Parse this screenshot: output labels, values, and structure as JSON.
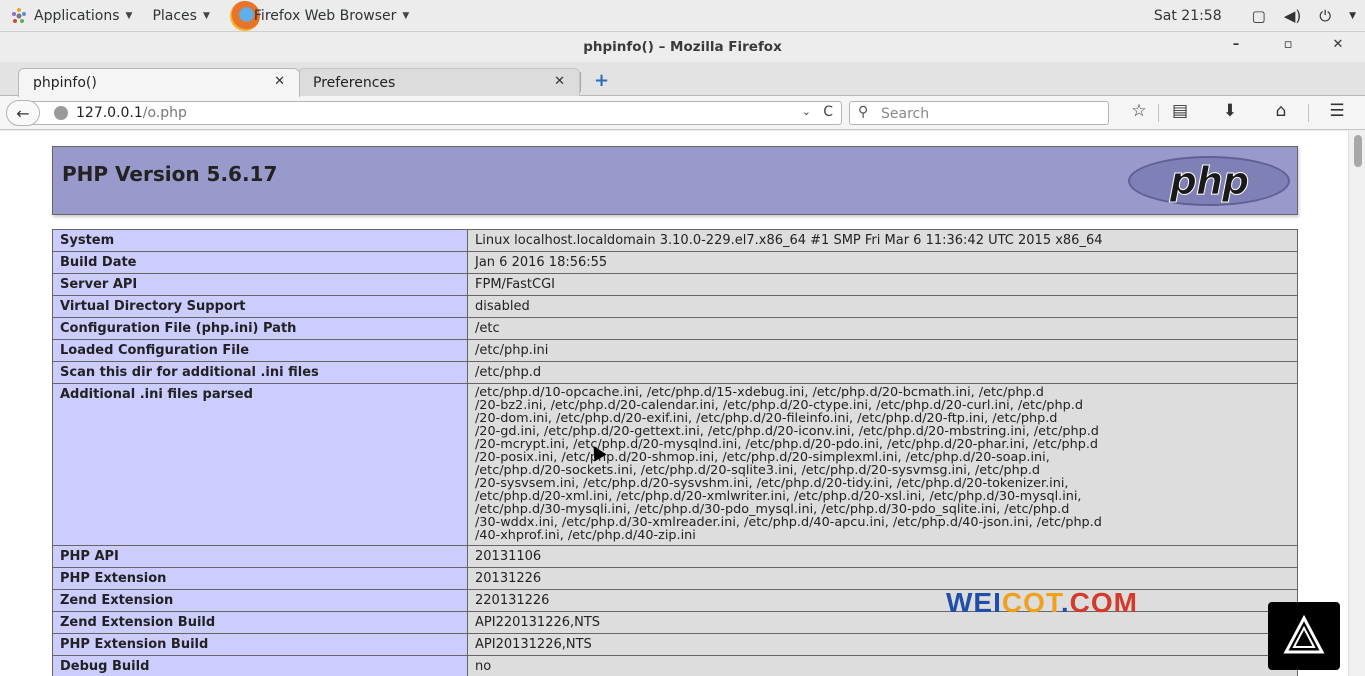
{
  "topbar": {
    "applications": "Applications",
    "places": "Places",
    "app_name": "Firefox Web Browser",
    "clock": "Sat 21:58"
  },
  "window": {
    "title": "phpinfo() – Mozilla Firefox",
    "minimize": "–",
    "maximize": "▫",
    "close": "✕"
  },
  "tabs": [
    {
      "label": "phpinfo()",
      "close": "✕"
    },
    {
      "label": "Preferences",
      "close": "✕"
    }
  ],
  "newtab": "+",
  "nav": {
    "url_host": "127.0.0.1",
    "url_path": "/o.php",
    "search_placeholder": "Search",
    "back": "←",
    "reload": "C",
    "url_dropdown": "⌄"
  },
  "php": {
    "version_title": "PHP Version 5.6.17",
    "logo": "php"
  },
  "info_rows": [
    {
      "key": "System",
      "value": "Linux localhost.localdomain 3.10.0-229.el7.x86_64 #1 SMP Fri Mar 6 11:36:42 UTC 2015 x86_64"
    },
    {
      "key": "Build Date",
      "value": "Jan 6 2016 18:56:55"
    },
    {
      "key": "Server API",
      "value": "FPM/FastCGI"
    },
    {
      "key": "Virtual Directory Support",
      "value": "disabled"
    },
    {
      "key": "Configuration File (php.ini) Path",
      "value": "/etc"
    },
    {
      "key": "Loaded Configuration File",
      "value": "/etc/php.ini"
    },
    {
      "key": "Scan this dir for additional .ini files",
      "value": "/etc/php.d"
    },
    {
      "key": "Additional .ini files parsed",
      "value": "/etc/php.d/10-opcache.ini, /etc/php.d/15-xdebug.ini, /etc/php.d/20-bcmath.ini, /etc/php.d\n/20-bz2.ini, /etc/php.d/20-calendar.ini, /etc/php.d/20-ctype.ini, /etc/php.d/20-curl.ini, /etc/php.d\n/20-dom.ini, /etc/php.d/20-exif.ini, /etc/php.d/20-fileinfo.ini, /etc/php.d/20-ftp.ini, /etc/php.d\n/20-gd.ini, /etc/php.d/20-gettext.ini, /etc/php.d/20-iconv.ini, /etc/php.d/20-mbstring.ini, /etc/php.d\n/20-mcrypt.ini, /etc/php.d/20-mysqlnd.ini, /etc/php.d/20-pdo.ini, /etc/php.d/20-phar.ini, /etc/php.d\n/20-posix.ini, /etc/php.d/20-shmop.ini, /etc/php.d/20-simplexml.ini, /etc/php.d/20-soap.ini,\n/etc/php.d/20-sockets.ini, /etc/php.d/20-sqlite3.ini, /etc/php.d/20-sysvmsg.ini, /etc/php.d\n/20-sysvsem.ini, /etc/php.d/20-sysvshm.ini, /etc/php.d/20-tidy.ini, /etc/php.d/20-tokenizer.ini,\n/etc/php.d/20-xml.ini, /etc/php.d/20-xmlwriter.ini, /etc/php.d/20-xsl.ini, /etc/php.d/30-mysql.ini,\n/etc/php.d/30-mysqli.ini, /etc/php.d/30-pdo_mysql.ini, /etc/php.d/30-pdo_sqlite.ini, /etc/php.d\n/30-wddx.ini, /etc/php.d/30-xmlreader.ini, /etc/php.d/40-apcu.ini, /etc/php.d/40-json.ini, /etc/php.d\n/40-xhprof.ini, /etc/php.d/40-zip.ini"
    },
    {
      "key": "PHP API",
      "value": "20131106"
    },
    {
      "key": "PHP Extension",
      "value": "20131226"
    },
    {
      "key": "Zend Extension",
      "value": "220131226"
    },
    {
      "key": "Zend Extension Build",
      "value": "API220131226,NTS"
    },
    {
      "key": "PHP Extension Build",
      "value": "API20131226,NTS"
    },
    {
      "key": "Debug Build",
      "value": "no"
    }
  ],
  "watermark": {
    "part1": "WEI",
    "part2": "COT",
    "part3": ".",
    "part4": "COM"
  },
  "colors": {
    "php_header": "#9999cc",
    "key_cell": "#ccccff",
    "value_cell": "#dddddd"
  }
}
